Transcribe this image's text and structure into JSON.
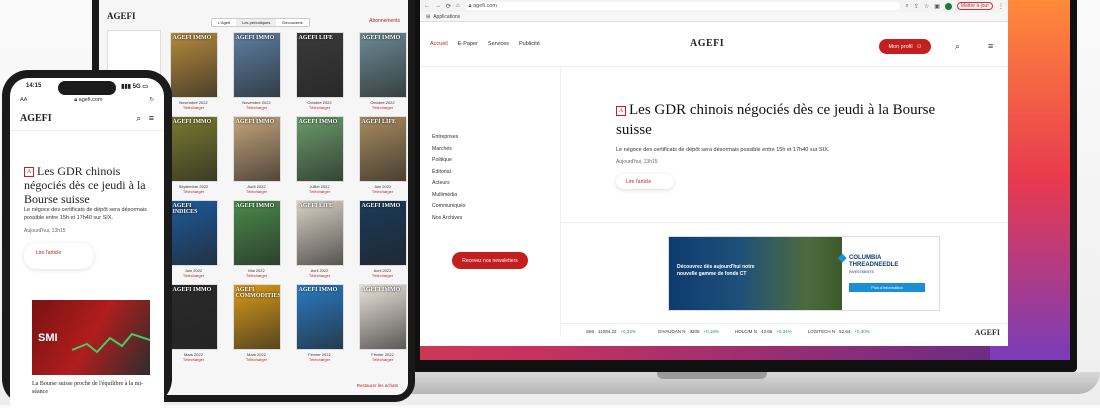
{
  "laptop": {
    "browser": {
      "url": "agefi.com",
      "bookmark": "Applications",
      "update_button": "Mettre à jour"
    },
    "header": {
      "nav": [
        "Accueil",
        "E-Paper",
        "Services",
        "Publicité"
      ],
      "logo": "AGEFI",
      "profile_button": "Mon profil"
    },
    "side_menu": [
      "Entreprises",
      "Marchés",
      "Politique",
      "Éditorial",
      "Acteurs",
      "Multimédia",
      "Communiqués",
      "Nos Archives"
    ],
    "newsletter_button": "Recevez nos newsletters",
    "article": {
      "badge": "A",
      "title": "Les GDR chinois négociés dès ce jeudi à la Bourse suisse",
      "lead": "Le négoce des certificats de dépôt sera désormais possible entre 15h et 17h40 sur SIX.",
      "date": "Aujourd'hui, 13h15",
      "read_button": "Lire l'article"
    },
    "ad": {
      "text": "Découvrez dès aujourd'hui notre nouvelle gamme de fonds CT",
      "logo_line1": "COLUMBIA",
      "logo_line2": "THREADNEEDLE",
      "logo_line3": "INVESTMENTS",
      "button": "Plus d'information"
    },
    "ticker": {
      "items": [
        {
          "name": "SMI",
          "value": "11084.22",
          "change": "+0,33%"
        },
        {
          "name": "GIVAUDAN N",
          "value": "3205",
          "change": "+0,18%"
        },
        {
          "name": "HOLCIM N",
          "value": "43.65",
          "change": "+0,34%"
        },
        {
          "name": "LOGITECH N",
          "value": "52.64",
          "change": "+0,30%"
        }
      ],
      "logo": "AGEFI"
    }
  },
  "tablet": {
    "logo": "AGEFI",
    "tabs": [
      "L'Agefi",
      "Les périodiques",
      "Découverte"
    ],
    "subscription_link": "Abonnements",
    "magazines": [
      {
        "title": "AGEFI IMMO",
        "date": "Novembre 2022",
        "color": "#b58a3c"
      },
      {
        "title": "AGEFI IMMO",
        "date": "Novembre 2022",
        "color": "#5c7fa3"
      },
      {
        "title": "AGEFI LIFE",
        "date": "Octobre 2022",
        "color": "#3a3a3a"
      },
      {
        "title": "AGEFI IMMO",
        "date": "Octobre 2022",
        "color": "#6b8a92"
      },
      {
        "title": "AGEFI IMMO",
        "date": "Septembre 2022",
        "color": "#7a7a2e"
      },
      {
        "title": "AGEFI IMMO",
        "date": "Août 2022",
        "color": "#c4a47a"
      },
      {
        "title": "AGEFI IMMO",
        "date": "Juillet 2022",
        "color": "#6a9a6a"
      },
      {
        "title": "AGEFI LIFE",
        "date": "Juin 2022",
        "color": "#a88b5e"
      },
      {
        "title": "AGEFI INDICES",
        "date": "Juin 2022",
        "color": "#1d5a9a"
      },
      {
        "title": "AGEFI IMMO",
        "date": "Mai 2022",
        "color": "#4a8a4a"
      },
      {
        "title": "AGEFI LIFE",
        "date": "Avril 2022",
        "color": "#d9d0c5"
      },
      {
        "title": "AGEFI IMMO",
        "date": "Avril 2022",
        "color": "#1a3a5a"
      },
      {
        "title": "AGEFI IMMO",
        "date": "Mars 2022",
        "color": "#2a2a2a"
      },
      {
        "title": "AGEFI COMMODITIES",
        "date": "Mars 2022",
        "color": "#d99a1a"
      },
      {
        "title": "AGEFI IMMO",
        "date": "Février 2022",
        "color": "#2a7ac2"
      },
      {
        "title": "AGEFI IMMO",
        "date": "Février 2022",
        "color": "#e8e2d8"
      }
    ],
    "download_label": "Télécharger",
    "restore_link": "Restaurer les achats"
  },
  "phone": {
    "time": "14:15",
    "network": "5G",
    "url": "agefi.com",
    "text_size": "AA",
    "logo": "AGEFI",
    "article": {
      "badge": "A",
      "title": "Les GDR chinois négociés dès ce jeudi à la Bourse suisse",
      "lead": "Le négoce des certificats de dépôt sera désormais possible entre 15h et 17h40 sur SIX.",
      "date": "Aujourd'hui, 13h15",
      "read_button": "Lire l'article"
    },
    "second_story": {
      "image_label": "SMI",
      "caption": "La Bourse suisse proche de l'équilibre à la mi-séance"
    }
  },
  "colors": {
    "brand_red": "#c41e1e",
    "ad_blue": "#1a8fd6",
    "positive_green": "#1a9a4a"
  }
}
